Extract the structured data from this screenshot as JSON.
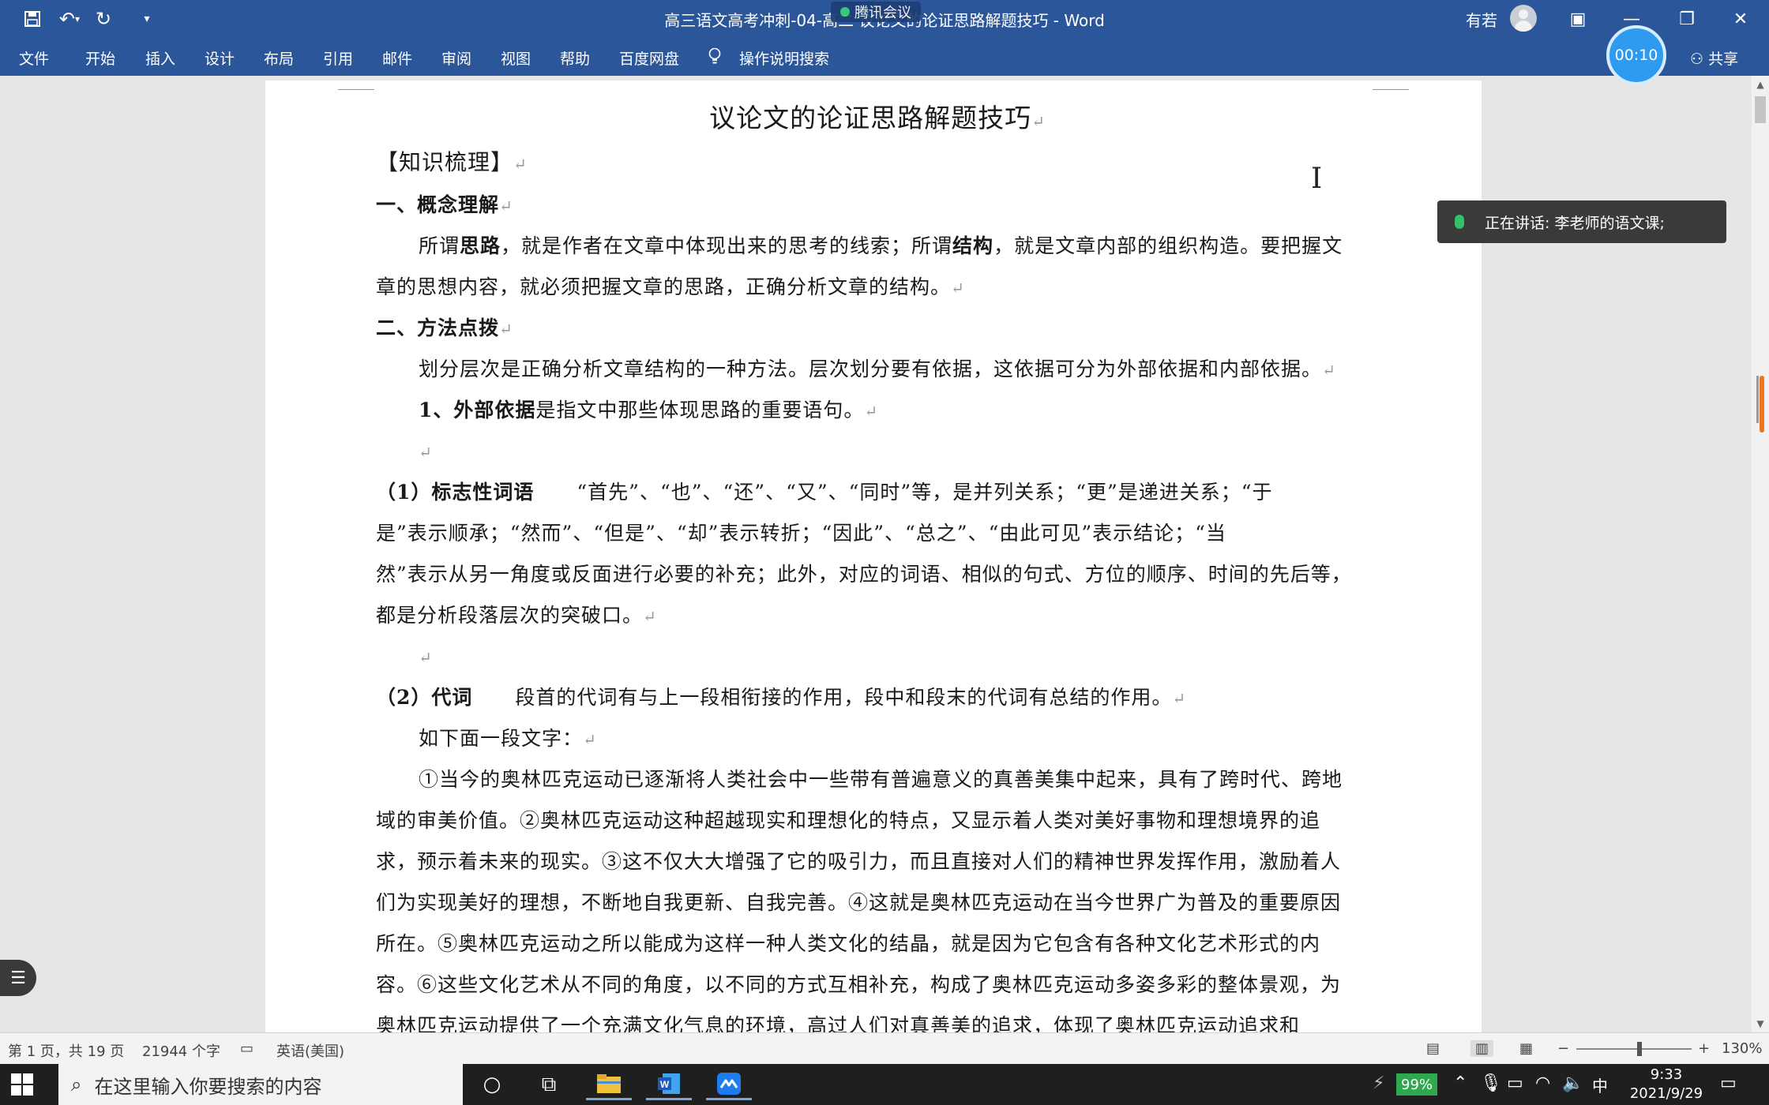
{
  "window": {
    "title": "高三语文高考冲刺-04-高二 议论文的论证思路解题技巧 - Word",
    "meeting_label": "腾讯会议",
    "user_name": "有若",
    "timer": "00:10"
  },
  "ribbon": {
    "tabs": [
      "文件",
      "开始",
      "插入",
      "设计",
      "布局",
      "引用",
      "邮件",
      "审阅",
      "视图",
      "帮助",
      "百度网盘"
    ],
    "tell_me": "操作说明搜索",
    "share": "共享"
  },
  "document": {
    "title": "议论文的论证思路解题技巧",
    "section": "【知识梳理】",
    "h_concept": "一、概念理解",
    "p1": {
      "a": "所谓",
      "b": "思路",
      "c": "，就是作者在文章中体现出来的思考的线索；所谓",
      "d": "结构",
      "e": "，就是文章内部的组织构造。要把握文",
      "line2": "章的思想内容，就必须把握文章的思路，正确分析文章的结构。"
    },
    "h_method": "二、方法点拨",
    "p2": "划分层次是正确分析文章结构的一种方法。层次划分要有依据，这依据可分为外部依据和内部依据。",
    "p3": {
      "bold": "1、外部依据",
      "rest": "是指文中那些体现思路的重要语句。"
    },
    "p4": {
      "label": "（1）标志性词语",
      "line1": "“首先”、“也”、“还”、“又”、“同时”等，是并列关系；“更”是递进关系；“于",
      "line2": "是”表示顺承；“然而”、“但是”、“却”表示转折；“因此”、“总之”、“由此可见”表示结论；“当",
      "line3": "然”表示从另一角度或反面进行必要的补充；此外，对应的词语、相似的句式、方位的顺序、时间的先后等，",
      "line4": "都是分析段落层次的突破口。"
    },
    "p5": {
      "label": "（2）代词",
      "rest": "段首的代词有与上一段相衔接的作用，段中和段末的代词有总结的作用。"
    },
    "p6": "如下面一段文字：",
    "passage": [
      "①当今的奥林匹克运动已逐渐将人类社会中一些带有普遍意义的真善美集中起来，具有了跨时代、跨地",
      "域的审美价值。②奥林匹克运动这种超越现实和理想化的特点，又显示着人类对美好事物和理想境界的追",
      "求，预示着未来的现实。③这不仅大大增强了它的吸引力，而且直接对人们的精神世界发挥作用，激励着人",
      "们为实现美好的理想，不断地自我更新、自我完善。④这就是奥林匹克运动在当今世界广为普及的重要原因",
      "所在。⑤奥林匹克运动之所以能成为这样一种人类文化的结晶，就是因为它包含有各种文化艺术形式的内",
      "容。⑥这些文化艺术从不同的角度，以不同的方式互相补充，构成了奥林匹克运动多姿多彩的整体景观，为",
      "奥林匹克运动提供了一个充满文化气息的环境，高过人们对真善美的追求，体现了奥林匹克运动追求和"
    ],
    "para_mark": "↵"
  },
  "overlay": {
    "speaking": "正在讲话: 李老师的语文课;"
  },
  "statusbar": {
    "page": "第 1 页，共 19 页",
    "words": "21944 个字",
    "language": "英语(美国)",
    "zoom_minus": "−",
    "zoom_plus": "+",
    "zoom": "130%",
    "zoom_fraction": 0.55
  },
  "taskbar": {
    "search_placeholder": "在这里输入你要搜索的内容",
    "battery": "99%",
    "ime": "中",
    "time": "9:33",
    "date": "2021/9/29"
  },
  "colors": {
    "word_blue": "#2b579a",
    "timer_blue": "#2e9bf0",
    "battery_green": "#2fa84f",
    "taskbar": "#1f1f1f"
  }
}
